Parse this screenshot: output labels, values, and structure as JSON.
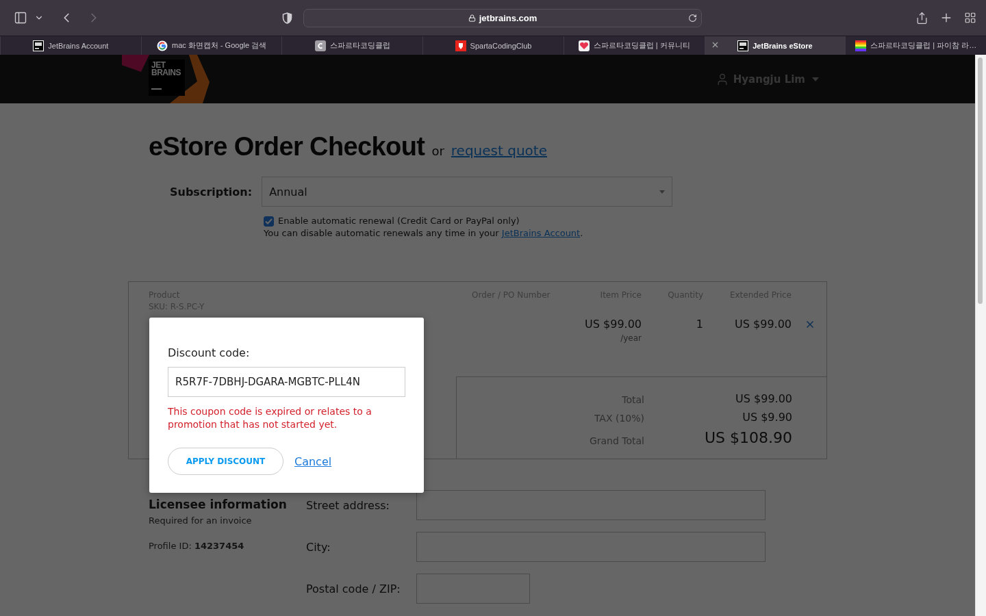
{
  "browser": {
    "nav": [
      {
        "kind": "back",
        "disabled": false
      },
      {
        "kind": "forward",
        "disabled": true
      }
    ],
    "url": "jetbrains.com",
    "tabs": [
      {
        "title": "JetBrains Account",
        "kind": "jb",
        "selected": false
      },
      {
        "title": "mac 화면캡처 - Google 검색",
        "kind": "google",
        "selected": false
      },
      {
        "title": "스파르타코딩클럽",
        "kind": "letter",
        "selected": false
      },
      {
        "title": "SpartaCodingClub",
        "kind": "red",
        "selected": false
      },
      {
        "title": "스파르타코딩클럽 | 커뮤니티",
        "kind": "heart",
        "selected": false
      },
      {
        "title": "JetBrains eStore",
        "kind": "jb",
        "selected": true
      },
      {
        "title": "스파르타코딩클럽 | 파이참 라…",
        "kind": "rainbow",
        "selected": false
      }
    ]
  },
  "header": {
    "logo_lines": [
      "JET",
      "BRAINS"
    ],
    "user": "Hyangju Lim"
  },
  "checkout": {
    "title": "eStore Order Checkout",
    "or": "or",
    "quote_link": "request quote",
    "subscription": {
      "label": "Subscription:",
      "value": "Annual"
    },
    "renewal": {
      "checked": true,
      "label": "Enable automatic renewal (Credit Card or PayPal only)",
      "note": "You can disable automatic renewals any time in your",
      "note_link": "JetBrains Account",
      "note_end": "."
    },
    "table": {
      "columns": [
        "Product",
        "Order / PO Number",
        "Item Price",
        "Quantity",
        "Extended Price"
      ],
      "rows": [
        {
          "sku": "SKU: R-S.PC-Y",
          "item_price": "US $99.00",
          "period": "/year",
          "quantity": "1",
          "extended_price": "US $99.00"
        }
      ]
    },
    "totals": [
      {
        "kind": "normal",
        "label": "Total",
        "value": "US $99.00"
      },
      {
        "kind": "normal",
        "label": "TAX (10%)",
        "value": "US $9.90"
      },
      {
        "kind": "grand",
        "label": "Grand Total",
        "value": "US $108.90"
      }
    ],
    "licensee": {
      "title": "Licensee information",
      "subtitle": "Required for an invoice",
      "profile": "Profile ID: **14237454**"
    },
    "address_fields": [
      {
        "kind": "wide",
        "label": "Street address:"
      },
      {
        "kind": "wide",
        "label": "City:"
      },
      {
        "kind": "short",
        "label": "Postal code / ZIP:"
      }
    ]
  },
  "modal": {
    "title": "Discount code:",
    "value": "R5R7F-7DBHJ-DGARA-MGBTC-PLL4N",
    "error": "This coupon code is expired or relates to a promotion that has not started yet.",
    "apply": "APPLY DISCOUNT",
    "cancel": "Cancel"
  }
}
